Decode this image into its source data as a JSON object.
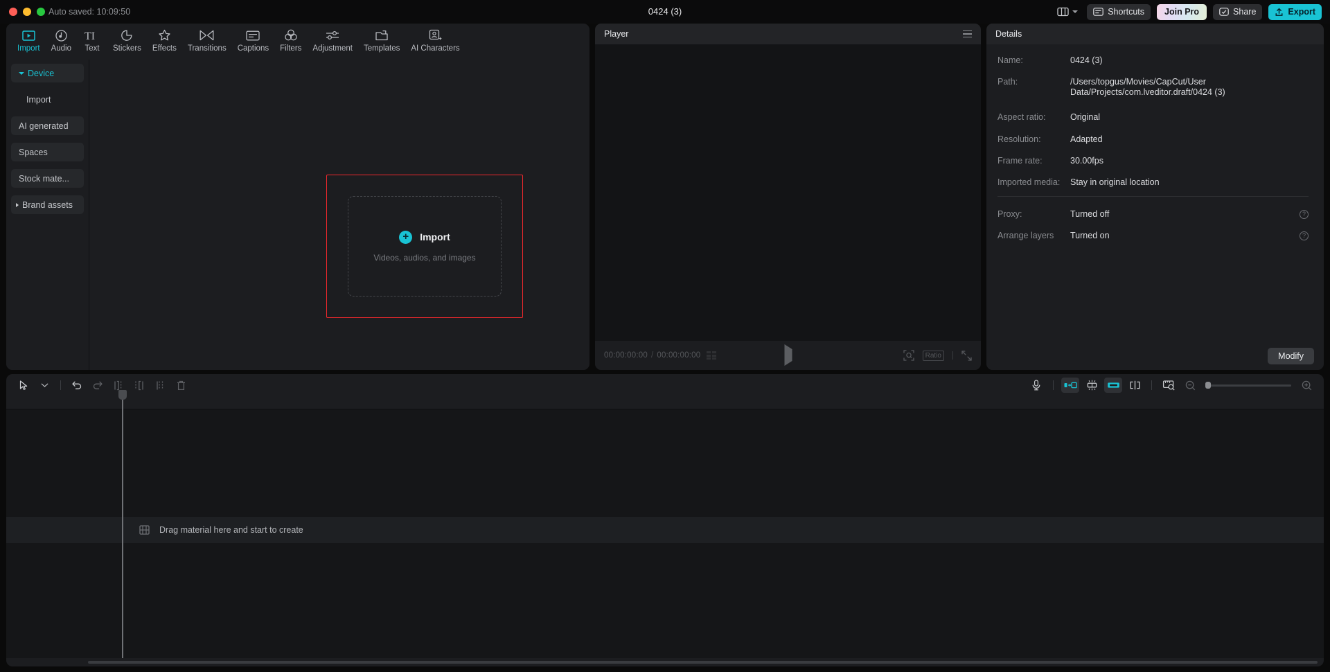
{
  "titlebar": {
    "autosave": "Auto saved: 10:09:50",
    "project_title": "0424 (3)",
    "layout_icon": "layout-icon",
    "buttons": {
      "shortcuts": "Shortcuts",
      "join_pro": "Join Pro",
      "share": "Share",
      "export": "Export"
    }
  },
  "nav_tabs": [
    {
      "label": "Import",
      "icon": "import-icon",
      "active": true
    },
    {
      "label": "Audio",
      "icon": "audio-note-icon",
      "active": false
    },
    {
      "label": "Text",
      "icon": "text-ti-icon",
      "active": false
    },
    {
      "label": "Stickers",
      "icon": "sticker-icon",
      "active": false
    },
    {
      "label": "Effects",
      "icon": "effects-star-icon",
      "active": false
    },
    {
      "label": "Transitions",
      "icon": "transitions-icon",
      "active": false
    },
    {
      "label": "Captions",
      "icon": "captions-icon",
      "active": false
    },
    {
      "label": "Filters",
      "icon": "filters-icon",
      "active": false
    },
    {
      "label": "Adjustment",
      "icon": "adjustment-icon",
      "active": false
    },
    {
      "label": "Templates",
      "icon": "templates-icon",
      "active": false
    },
    {
      "label": "AI Characters",
      "icon": "ai-characters-icon",
      "active": false
    }
  ],
  "sidebar": {
    "items": [
      {
        "label": "Device",
        "type": "device",
        "expanded": true
      },
      {
        "label": "Import",
        "type": "sub"
      },
      {
        "label": "AI generated",
        "type": "chip"
      },
      {
        "label": "Spaces",
        "type": "chip"
      },
      {
        "label": "Stock mate...",
        "type": "chip"
      },
      {
        "label": "Brand assets",
        "type": "chip",
        "collapsed": true
      }
    ]
  },
  "dropzone": {
    "title": "Import",
    "subtitle": "Videos, audios, and images",
    "plus_icon": "plus-circle-icon",
    "highlight_color": "#f0282d"
  },
  "player": {
    "title": "Player",
    "menu_icon": "hamburger-icon",
    "current_time": "00:00:00:00",
    "total_time": "00:00:00:00",
    "time_separator": "/",
    "play_icon": "play-icon",
    "snapshot_icon": "snapshot-icon",
    "ratio_label": "Ratio",
    "fullscreen_icon": "fullscreen-icon"
  },
  "details": {
    "title": "Details",
    "rows": [
      {
        "key": "Name:",
        "value": "0424 (3)"
      },
      {
        "key": "Path:",
        "value": "/Users/topgus/Movies/CapCut/User Data/Projects/com.lveditor.draft/0424 (3)"
      },
      {
        "key": "Aspect ratio:",
        "value": "Original"
      },
      {
        "key": "Resolution:",
        "value": "Adapted"
      },
      {
        "key": "Frame rate:",
        "value": "30.00fps"
      },
      {
        "key": "Imported media:",
        "value": "Stay in original location"
      }
    ],
    "toggles": [
      {
        "key": "Proxy:",
        "value": "Turned off",
        "help_icon": "question-icon"
      },
      {
        "key": "Arrange layers",
        "value": "Turned on",
        "help_icon": "question-icon"
      }
    ],
    "modify_label": "Modify"
  },
  "timeline": {
    "empty_text": "Drag material here and start to create",
    "empty_icon": "film-strip-icon",
    "left_tools": [
      {
        "name": "select-cursor-tool",
        "icon": "cursor-icon"
      },
      {
        "name": "tool-dropdown",
        "icon": "chevron-down-icon"
      },
      {
        "name": "undo-button",
        "icon": "undo-icon"
      },
      {
        "name": "redo-button",
        "icon": "redo-icon"
      },
      {
        "name": "split-button",
        "icon": "split-icon"
      },
      {
        "name": "trim-left-button",
        "icon": "trim-left-icon"
      },
      {
        "name": "trim-right-button",
        "icon": "trim-right-icon"
      },
      {
        "name": "delete-button",
        "icon": "trash-icon"
      }
    ],
    "right_tools": [
      {
        "name": "record-voiceover-button",
        "icon": "microphone-icon",
        "active": false
      },
      {
        "name": "auto-snap-button",
        "icon": "snap-left-icon",
        "active": true
      },
      {
        "name": "auto-arrange-button",
        "icon": "arrange-icon",
        "active": false
      },
      {
        "name": "link-clips-button",
        "icon": "link-icon",
        "active": true
      },
      {
        "name": "adsorption-button",
        "icon": "magnet-split-icon",
        "active": false
      },
      {
        "name": "preview-scale-button",
        "icon": "ruler-zoom-icon",
        "active": false
      }
    ],
    "zoom_out_icon": "zoom-out-icon",
    "zoom_in_icon": "zoom-in-icon"
  },
  "colors": {
    "accent": "#19c3d4",
    "panel_bg": "#1c1d20",
    "app_bg": "#0a0a0a",
    "highlight": "#f0282d"
  }
}
